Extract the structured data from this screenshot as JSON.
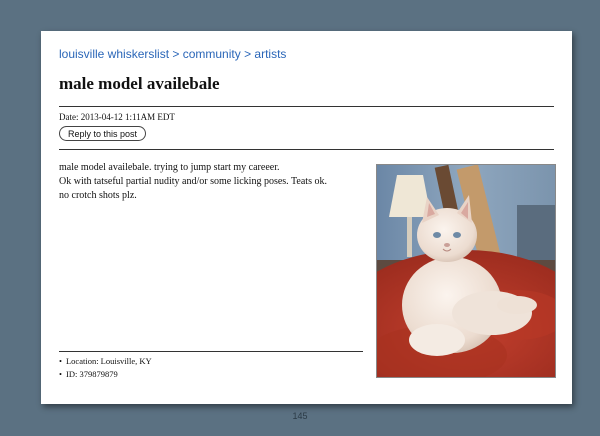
{
  "breadcrumb": {
    "site": "louisville whiskerslist",
    "separator": " > ",
    "section": "community",
    "category": "artists"
  },
  "post": {
    "title": "male model availebale",
    "date": "Date: 2013-04-12 1:11AM EDT",
    "reply_label": "Reply to this post",
    "body_lines": [
      "male model availebale. trying to jump start my careeer.",
      "Ok with tatseful partial nudity and/or some licking poses. Teats ok.",
      "no crotch shots plz."
    ],
    "attributes": [
      "Location: Louisville, KY",
      "ID: 379879879"
    ],
    "photo_subject": "white long-haired cat sitting on red rug"
  },
  "page_number": "145",
  "colors": {
    "background": "#5b7182",
    "link": "#2a66b8",
    "page": "#ffffff"
  }
}
